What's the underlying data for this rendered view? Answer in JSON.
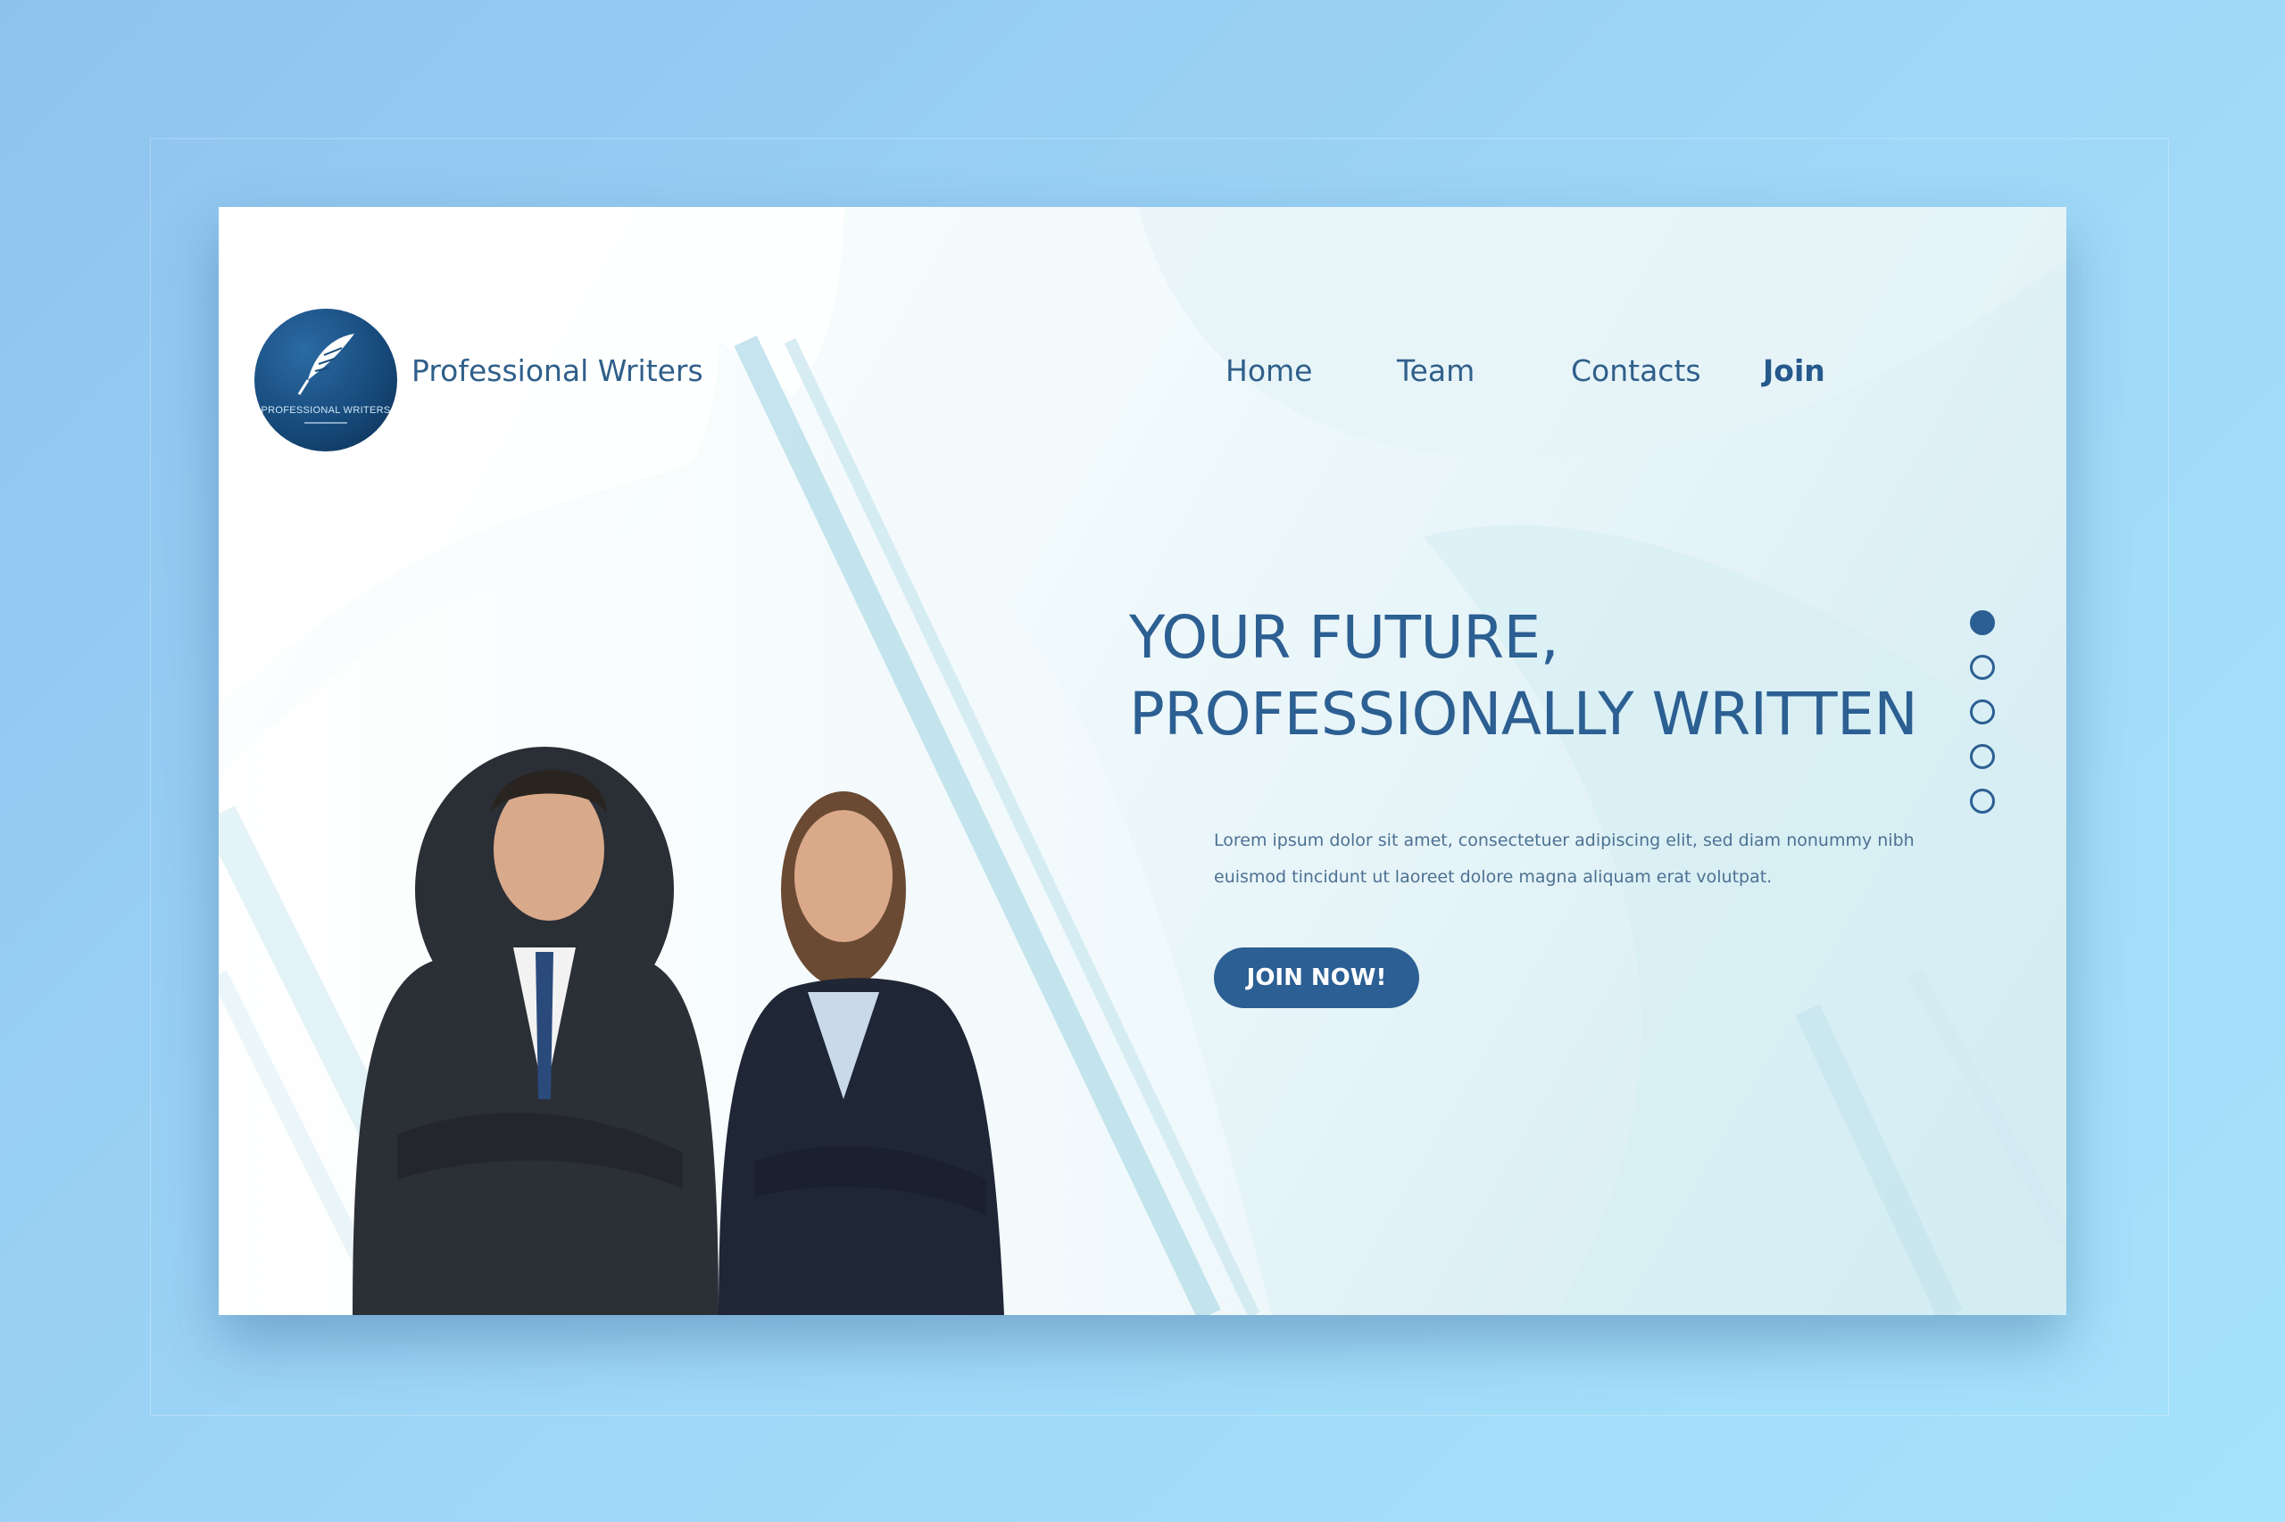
{
  "brand": {
    "name": "Professional Writers",
    "logo_text": "PROFESSIONAL WRITERS",
    "logo_icon": "feather-icon"
  },
  "nav": {
    "items": [
      {
        "label": "Home",
        "active": false
      },
      {
        "label": "Team",
        "active": false
      },
      {
        "label": "Contacts",
        "active": false
      },
      {
        "label": "Join",
        "active": true
      }
    ]
  },
  "hero": {
    "title_lines": [
      "YOUR FUTURE,",
      "PROFESSIONALLY WRITTEN"
    ],
    "text_lines": [
      "Lorem ipsum dolor sit amet, consectetuer adipiscing elit, sed diam nonummy nibh",
      "euismod tincidunt ut laoreet dolore magna aliquam erat volutpat."
    ],
    "cta_label": "JOIN NOW!"
  },
  "pagination": {
    "count": 5,
    "active_index": 0
  },
  "image": {
    "subject": "two-business-people-photo"
  },
  "colors": {
    "primary": "#2c5f93",
    "text": "#2f5f8a",
    "page_bg": "#9fd8f8"
  }
}
